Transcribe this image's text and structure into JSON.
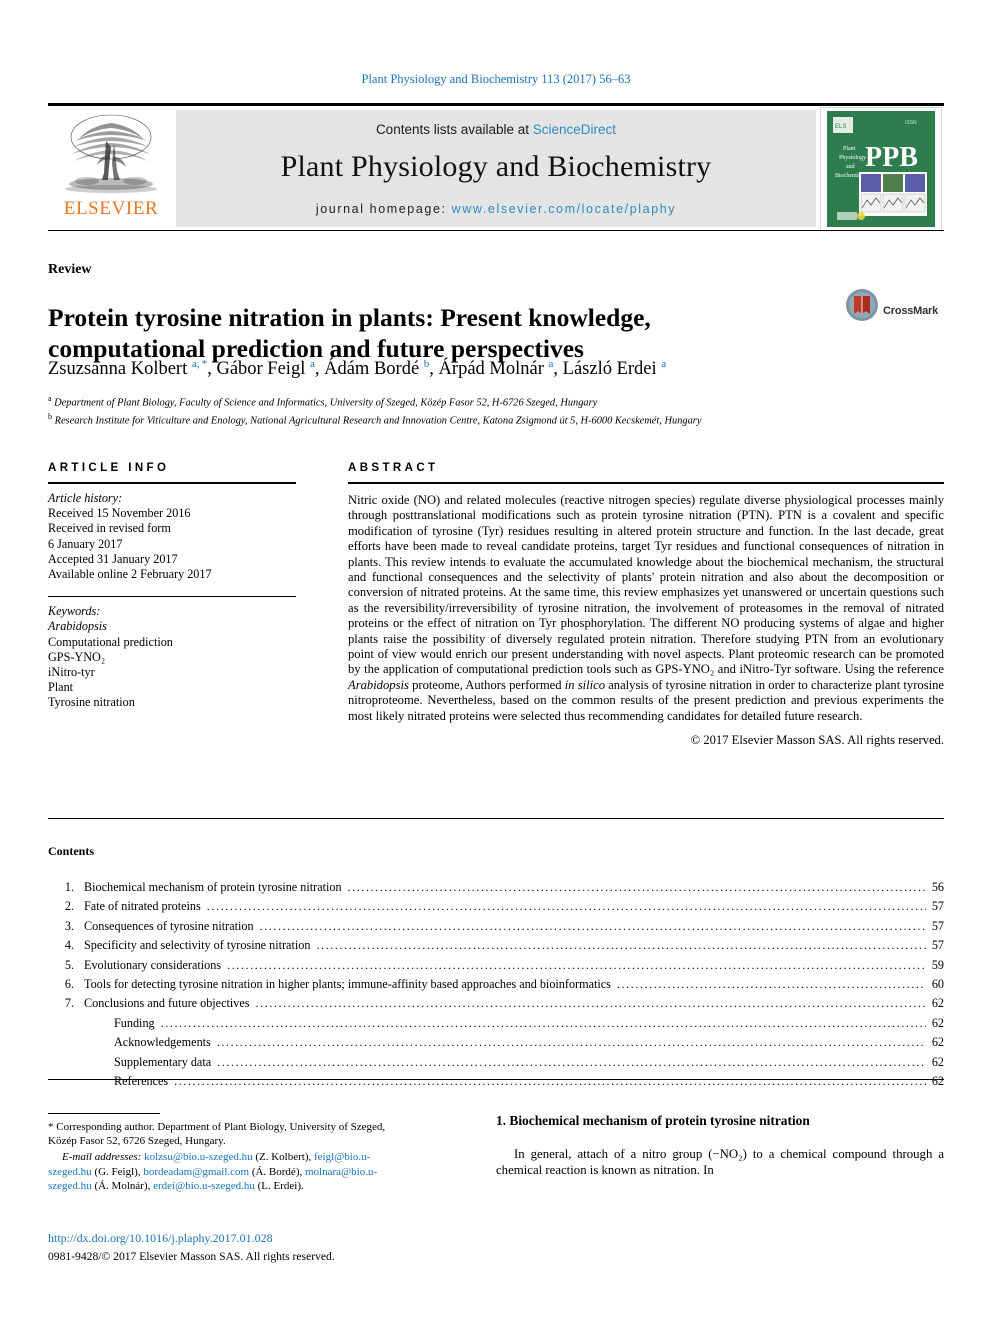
{
  "running_head": "Plant Physiology and Biochemistry 113 (2017) 56–63",
  "masthead": {
    "publisher": "ELSEVIER",
    "contents_prefix": "Contents lists available at ",
    "contents_link": "ScienceDirect",
    "journal_name": "Plant Physiology and Biochemistry",
    "homepage_prefix": "journal homepage: ",
    "homepage_url": "www.elsevier.com/locate/plaphy",
    "cover_abbrev": "PPB",
    "cover_title_lines": [
      "Plant",
      "Physiology",
      "and",
      "Biochemistry"
    ],
    "cover_color": "#2e7d4f"
  },
  "article": {
    "type_label": "Review",
    "title": "Protein tyrosine nitration in plants: Present knowledge, computational prediction and future perspectives",
    "crossmark_label": "CrossMark",
    "authors_html": "Zsuzsanna Kolbert <sup>a, *</sup>, Gábor Feigl <sup>a</sup>, Ádám Bordé <sup>b</sup>, Árpád Molnár <sup>a</sup>, László Erdei <sup>a</sup>",
    "affiliations": [
      "Department of Plant Biology, Faculty of Science and Informatics, University of Szeged, Közép Fasor 52, H-6726 Szeged, Hungary",
      "Research Institute for Viticulture and Enology, National Agricultural Research and Innovation Centre, Katona Zsigmond út 5, H-6000 Kecskemét, Hungary"
    ],
    "affiliation_marks": [
      "a",
      "b"
    ]
  },
  "article_info": {
    "heading": "ARTICLE INFO",
    "history_label": "Article history:",
    "history": [
      "Received 15 November 2016",
      "Received in revised form",
      "6 January 2017",
      "Accepted 31 January 2017",
      "Available online 2 February 2017"
    ],
    "keywords_label": "Keywords:",
    "keywords": [
      "Arabidopsis",
      "Computational prediction",
      "GPS-YNO2",
      "iNitro-tyr",
      "Plant",
      "Tyrosine nitration"
    ],
    "keyword_italic_index": 0,
    "keyword_subscript": "GPS-YNO₂"
  },
  "abstract": {
    "heading": "ABSTRACT",
    "body": "Nitric oxide (NO) and related molecules (reactive nitrogen species) regulate diverse physiological processes mainly through posttranslational modifications such as protein tyrosine nitration (PTN). PTN is a covalent and specific modification of tyrosine (Tyr) residues resulting in altered protein structure and function. In the last decade, great efforts have been made to reveal candidate proteins, target Tyr residues and functional consequences of nitration in plants. This review intends to evaluate the accumulated knowledge about the biochemical mechanism, the structural and functional consequences and the selectivity of plants' protein nitration and also about the decomposition or conversion of nitrated proteins. At the same time, this review emphasizes yet unanswered or uncertain questions such as the reversibility/irreversibility of tyrosine nitration, the involvement of proteasomes in the removal of nitrated proteins or the effect of nitration on Tyr phosphorylation. The different NO producing systems of algae and higher plants raise the possibility of diversely regulated protein nitration. Therefore studying PTN from an evolutionary point of view would enrich our present understanding with novel aspects. Plant proteomic research can be promoted by the application of computational prediction tools such as GPS-YNO₂ and iNitro-Tyr software. Using the reference Arabidopsis proteome, Authors performed in silico analysis of tyrosine nitration in order to characterize plant tyrosine nitroproteome. Nevertheless, based on the common results of the present prediction and previous experiments the most likely nitrated proteins were selected thus recommending candidates for detailed future research.",
    "copyright": "© 2017 Elsevier Masson SAS. All rights reserved."
  },
  "contents": {
    "heading": "Contents",
    "entries": [
      {
        "num": "1.",
        "title": "Biochemical mechanism of protein tyrosine nitration",
        "page": "56",
        "sub": false
      },
      {
        "num": "2.",
        "title": "Fate of nitrated proteins",
        "page": "57",
        "sub": false
      },
      {
        "num": "3.",
        "title": "Consequences of tyrosine nitration",
        "page": "57",
        "sub": false
      },
      {
        "num": "4.",
        "title": "Specificity and selectivity of tyrosine nitration",
        "page": "57",
        "sub": false
      },
      {
        "num": "5.",
        "title": "Evolutionary considerations",
        "page": "59",
        "sub": false
      },
      {
        "num": "6.",
        "title": "Tools for detecting tyrosine nitration in higher plants; immune-affinity based approaches and bioinformatics",
        "page": "60",
        "sub": false
      },
      {
        "num": "7.",
        "title": "Conclusions and future objectives",
        "page": "62",
        "sub": false
      },
      {
        "num": "",
        "title": "Funding",
        "page": "62",
        "sub": true
      },
      {
        "num": "",
        "title": "Acknowledgements",
        "page": "62",
        "sub": true
      },
      {
        "num": "",
        "title": "Supplementary data",
        "page": "62",
        "sub": true
      },
      {
        "num": "",
        "title": "References",
        "page": "62",
        "sub": true
      }
    ]
  },
  "footer": {
    "corresponding_note": "* Corresponding author. Department of Plant Biology, University of Szeged, Közép Fasor 52, 6726 Szeged, Hungary.",
    "email_label": "E-mail addresses:",
    "emails": [
      {
        "address": "kolzsu@bio.u-szeged.hu",
        "owner": "(Z. Kolbert)"
      },
      {
        "address": "feigl@bio.u-szeged.hu",
        "owner": "(G. Feigl)"
      },
      {
        "address": "bordeadam@gmail.com",
        "owner": "(Á. Bordé)"
      },
      {
        "address": "molnara@bio.u-szeged.hu",
        "owner": "(Á. Molnár)"
      },
      {
        "address": "erdei@bio.u-szeged.hu",
        "owner": "(L. Erdei)"
      }
    ],
    "doi": "http://dx.doi.org/10.1016/j.plaphy.2017.01.028",
    "issn_line": "0981-9428/© 2017 Elsevier Masson SAS. All rights reserved."
  },
  "body": {
    "section_number": "1.",
    "section_title": "Biochemical mechanism of protein tyrosine nitration",
    "paragraph": "In general, attach of a nitro group (−NO₂) to a chemical compound through a chemical reaction is known as nitration. In"
  },
  "colors": {
    "link": "#1a72b8",
    "sciencedirect": "#2b8cc4",
    "elsevier_orange": "#e87722",
    "band_gray": "#e4e4e4"
  }
}
